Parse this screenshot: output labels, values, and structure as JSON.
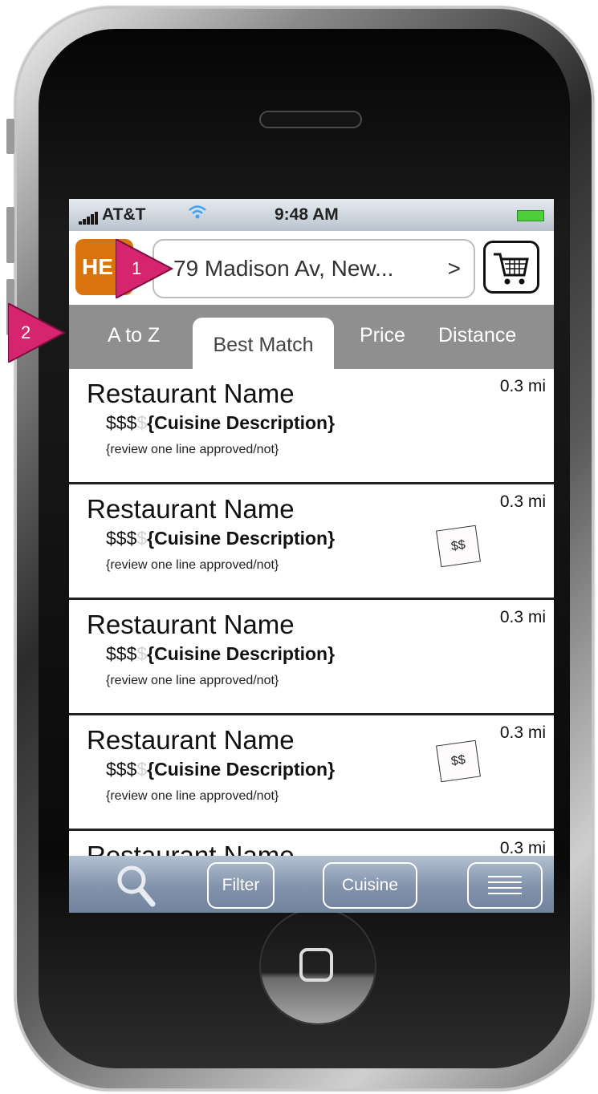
{
  "status_bar": {
    "carrier": "AT&T",
    "time": "9:48 AM"
  },
  "header": {
    "logo_text": "HE",
    "address": "79 Madison Av, New...",
    "address_chevron": ">",
    "cart_icon": "cart-icon"
  },
  "tabs": [
    {
      "label": "A to Z",
      "active": false
    },
    {
      "label": "Best Match",
      "active": true
    },
    {
      "label": "Price",
      "active": false
    },
    {
      "label": "Distance",
      "active": false
    }
  ],
  "restaurants": [
    {
      "name": "Restaurant Name",
      "distance": "0.3 mi",
      "price_filled": "$$$",
      "price_dim": "$",
      "cuisine": "{Cuisine Description}",
      "review": "{review one line approved/not}",
      "deal": ""
    },
    {
      "name": "Restaurant Name",
      "distance": "0.3 mi",
      "price_filled": "$$$",
      "price_dim": "$",
      "cuisine": "{Cuisine Description}",
      "review": "{review one line approved/not}",
      "deal": "$$"
    },
    {
      "name": "Restaurant Name",
      "distance": "0.3 mi",
      "price_filled": "$$$",
      "price_dim": "$",
      "cuisine": "{Cuisine Description}",
      "review": "{review one line approved/not}",
      "deal": ""
    },
    {
      "name": "Restaurant Name",
      "distance": "0.3 mi",
      "price_filled": "$$$",
      "price_dim": "$",
      "cuisine": "{Cuisine Description}",
      "review": "{review one line approved/not}",
      "deal": "$$"
    },
    {
      "name": "Restaurant Name",
      "distance": "0.3 mi",
      "price_filled": "",
      "price_dim": "",
      "cuisine": "",
      "review": "",
      "deal": ""
    }
  ],
  "toolbar": {
    "filter_label": "Filter",
    "cuisine_label": "Cuisine"
  },
  "annotations": {
    "marker_1": "1",
    "marker_2": "2"
  },
  "colors": {
    "marker": "#d6246e",
    "logo": "#d9730d",
    "tab_bar": "#8f8f8f"
  }
}
